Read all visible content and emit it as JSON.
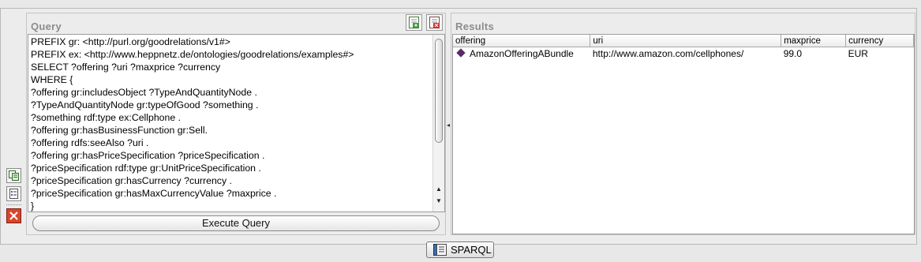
{
  "query_panel": {
    "title": "Query",
    "code_lines": [
      "PREFIX gr: <http://purl.org/goodrelations/v1#>",
      "PREFIX ex: <http://www.heppnetz.de/ontologies/goodrelations/examples#>",
      "SELECT ?offering ?uri ?maxprice ?currency",
      "WHERE {",
      "?offering gr:includesObject ?TypeAndQuantityNode .",
      "?TypeAndQuantityNode gr:typeOfGood ?something .",
      "?something rdf:type ex:Cellphone .",
      "?offering gr:hasBusinessFunction gr:Sell.",
      "?offering rdfs:seeAlso ?uri .",
      "?offering gr:hasPriceSpecification ?priceSpecification .",
      "?priceSpecification rdf:type gr:UnitPriceSpecification .",
      "?priceSpecification gr:hasCurrency ?currency .",
      "?priceSpecification gr:hasMaxCurrencyValue ?maxprice .",
      "}"
    ],
    "execute_label": "Execute Query"
  },
  "results_panel": {
    "title": "Results",
    "columns": [
      "offering",
      "uri",
      "maxprice",
      "currency"
    ],
    "rows": [
      [
        "AmazonOfferingABundle",
        "http://www.amazon.com/cellphones/",
        "99.0",
        "EUR"
      ]
    ]
  },
  "footer": {
    "sparql_label": "SPARQL"
  },
  "icons": {
    "query_toolbar": [
      "add-query-icon",
      "remove-query-icon"
    ],
    "left_toolbar": [
      "restore-view-icon",
      "list-view-icon",
      "close-icon"
    ],
    "row_marker": "individual-diamond-icon"
  },
  "colors": {
    "close_button": "#d9452b",
    "individual_marker": "#5a2a6a"
  }
}
